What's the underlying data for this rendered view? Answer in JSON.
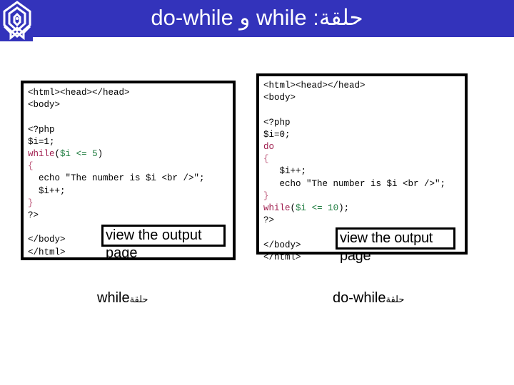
{
  "header": {
    "title": "do-while و while  :حلقة",
    "background_color": "#3333bb",
    "text_color": "#ffffff",
    "logo_icon": "hexagon-monogram-logo-icon"
  },
  "panels": [
    {
      "id": "while",
      "name": "while-loop-code-panel",
      "lines": [
        [
          {
            "t": "<html><head></head>",
            "c": "punct"
          }
        ],
        [
          {
            "t": "<body>",
            "c": "punct"
          }
        ],
        [
          {
            "t": " ",
            "c": "blank"
          }
        ],
        [
          {
            "t": "<?php",
            "c": "punct"
          }
        ],
        [
          {
            "t": "$i=1;",
            "c": "punct"
          }
        ],
        [
          {
            "t": "while",
            "c": "kw"
          },
          {
            "t": "(",
            "c": "punct"
          },
          {
            "t": "$i",
            "c": "var"
          },
          {
            "t": " ",
            "c": "punct"
          },
          {
            "t": "<=",
            "c": "op"
          },
          {
            "t": " ",
            "c": "punct"
          },
          {
            "t": "5",
            "c": "num"
          },
          {
            "t": ")",
            "c": "punct"
          }
        ],
        [
          {
            "t": "{",
            "c": "brace"
          }
        ],
        [
          {
            "t": "  echo \"The number is $i <br />\";",
            "c": "punct"
          }
        ],
        [
          {
            "t": "  $i++;",
            "c": "punct"
          }
        ],
        [
          {
            "t": "}",
            "c": "brace"
          }
        ],
        [
          {
            "t": "?>",
            "c": "punct"
          }
        ],
        [
          {
            "t": " ",
            "c": "blank"
          }
        ],
        [
          {
            "t": "</body>",
            "c": "punct"
          }
        ],
        [
          {
            "t": "</html>",
            "c": "punct"
          }
        ]
      ],
      "view_button": {
        "label": "view the output page",
        "name": "view-output-page-button-while"
      },
      "caption": {
        "latin": "while",
        "arabic": "حلقة"
      }
    },
    {
      "id": "dowhile",
      "name": "do-while-loop-code-panel",
      "lines": [
        [
          {
            "t": "<html><head></head>",
            "c": "punct"
          }
        ],
        [
          {
            "t": "<body>",
            "c": "punct"
          }
        ],
        [
          {
            "t": " ",
            "c": "blank"
          }
        ],
        [
          {
            "t": "<?php",
            "c": "punct"
          }
        ],
        [
          {
            "t": "$i=0;",
            "c": "punct"
          }
        ],
        [
          {
            "t": "do",
            "c": "kw"
          }
        ],
        [
          {
            "t": "{",
            "c": "brace"
          }
        ],
        [
          {
            "t": "   $i++;",
            "c": "punct"
          }
        ],
        [
          {
            "t": "   echo \"The number is $i <br />\";",
            "c": "punct"
          }
        ],
        [
          {
            "t": "}",
            "c": "brace"
          }
        ],
        [
          {
            "t": "while",
            "c": "kw"
          },
          {
            "t": "(",
            "c": "punct"
          },
          {
            "t": "$i",
            "c": "var"
          },
          {
            "t": " ",
            "c": "punct"
          },
          {
            "t": "<=",
            "c": "op"
          },
          {
            "t": " ",
            "c": "punct"
          },
          {
            "t": "10",
            "c": "num"
          },
          {
            "t": ");",
            "c": "punct"
          }
        ],
        [
          {
            "t": "?>",
            "c": "punct"
          }
        ],
        [
          {
            "t": " ",
            "c": "blank"
          }
        ],
        [
          {
            "t": "</body>",
            "c": "punct"
          }
        ],
        [
          {
            "t": "</html>",
            "c": "punct"
          }
        ]
      ],
      "view_button": {
        "label": "view the output page",
        "name": "view-output-page-button-dowhile"
      },
      "caption": {
        "latin": "do-while",
        "arabic": "حلقة"
      }
    }
  ],
  "colors": {
    "header_blue": "#3333bb",
    "keyword_maroon": "#a02050",
    "variable_green": "#1a7a3c",
    "brace_pink": "#c06080",
    "border_black": "#000000",
    "page_white": "#ffffff"
  }
}
